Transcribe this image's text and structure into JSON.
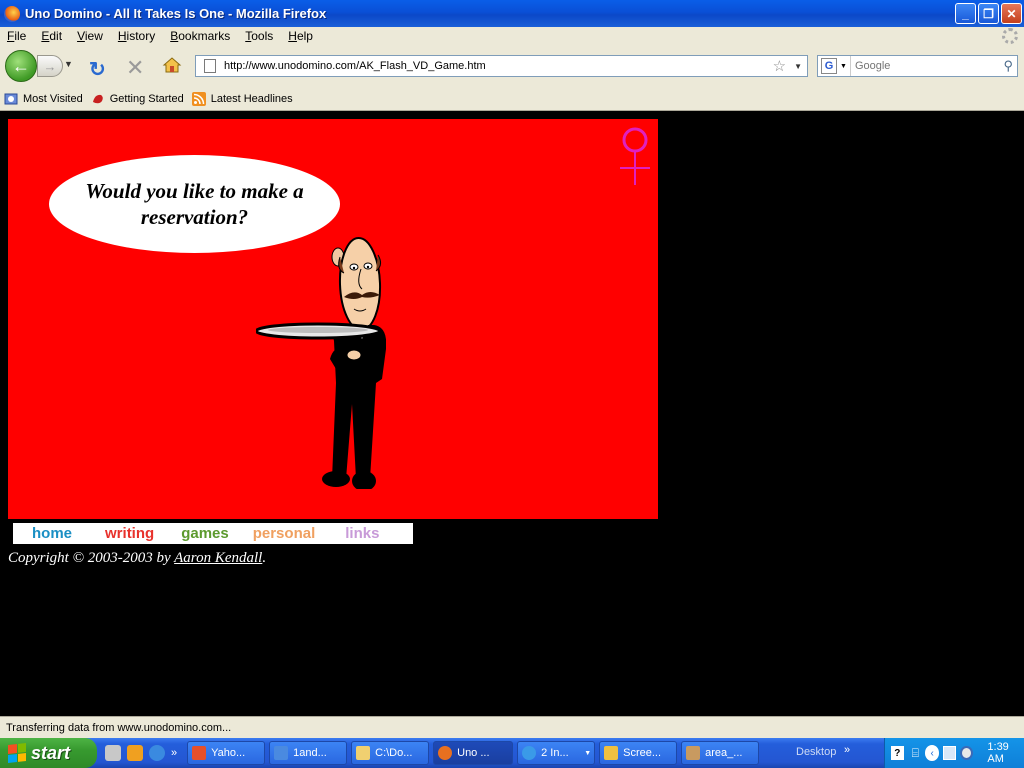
{
  "window": {
    "title": "Uno Domino - All It Takes Is One - Mozilla Firefox"
  },
  "menu": [
    "File",
    "Edit",
    "View",
    "History",
    "Bookmarks",
    "Tools",
    "Help"
  ],
  "nav": {
    "url": "http://www.unodomino.com/AK_Flash_VD_Game.htm",
    "search_placeholder": "Google"
  },
  "bookmarks": [
    {
      "label": "Most Visited",
      "icon": "most-visited-icon"
    },
    {
      "label": "Getting Started",
      "icon": "getting-started-icon"
    },
    {
      "label": "Latest Headlines",
      "icon": "rss-feed-icon"
    }
  ],
  "flash": {
    "speech": "Would  you like to make a reservation?",
    "background": "#ff0000"
  },
  "site_nav": [
    {
      "label": "home",
      "color": "#1a8fc4"
    },
    {
      "label": "writing",
      "color": "#e8322c"
    },
    {
      "label": "games",
      "color": "#5c9a2e"
    },
    {
      "label": "personal",
      "color": "#f0a060"
    },
    {
      "label": "links",
      "color": "#c89ad8"
    }
  ],
  "copyright": {
    "prefix": "Copyright © 2003-2003 by ",
    "author": "Aaron Kendall",
    "suffix": "."
  },
  "status": "Transferring data from www.unodomino.com...",
  "taskbar": {
    "start": "start",
    "tasks": [
      {
        "label": "Yaho...",
        "icon_color": "#e6502a"
      },
      {
        "label": "1and...",
        "icon_color": "#4a8ae0"
      },
      {
        "label": "C:\\Do...",
        "icon_color": "#f0d070"
      },
      {
        "label": "Uno ...",
        "icon_color": "#e87020"
      },
      {
        "label": "2 In...",
        "icon_color": "#3a9ae8"
      },
      {
        "label": "Scree...",
        "icon_color": "#f0c040"
      },
      {
        "label": "area_...",
        "icon_color": "#c89a60"
      }
    ],
    "desktop_label": "Desktop",
    "clock": "1:39 AM"
  }
}
